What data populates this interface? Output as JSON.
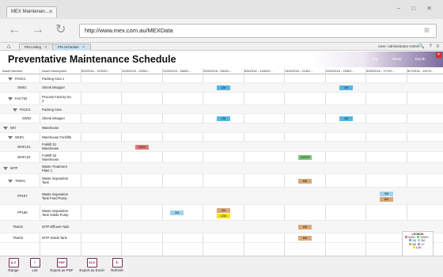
{
  "browser": {
    "tab_title": "MEX Maintenan...",
    "tab_close": "✕",
    "url": "http://www.mex.com.au/MEXData",
    "back_glyph": "←",
    "forward_glyph": "→",
    "refresh_glyph": "↻",
    "menu_glyph": "≡",
    "window_controls": "– □ ✕"
  },
  "app_tabs": [
    {
      "label": "PM Listing",
      "close": "✕"
    },
    {
      "label": "PM Schedule",
      "close": "✕"
    }
  ],
  "user_label": "User: Administrator Admin",
  "top_icons": "🔍 ? ≡",
  "page_title": "Preventative Maintenance Schedule",
  "view_buttons": {
    "day": "Day",
    "week": "Week",
    "month": "Month"
  },
  "close_glyph": "✕",
  "columns": {
    "asset_number": "Asset Number",
    "asset_description": "Asset Description",
    "weeks": [
      "5/5/2016 - 12/5/20...",
      "12/5/2016 - 20/5/2...",
      "21/5/2016 - 28/5/2...",
      "29/5/2016 - 5/6/20...",
      "6/6/2016 - 13/6/20...",
      "14/6/2016 - 21/6/2...",
      "22/6/2016 - 29/6/2...",
      "30/6/2016 - 7/7/20...",
      "8/7/2016 - 15/7/2..."
    ]
  },
  "rows": [
    {
      "num": "PACK1",
      "desc": [
        "Packing Area 1"
      ],
      "arrow": true,
      "indent": 1,
      "chips": []
    },
    {
      "num": "SW01",
      "desc": [
        "Shrink Wrapper"
      ],
      "arrow": false,
      "indent": 2,
      "chips": [
        {
          "label": "1M",
          "col": 3,
          "color": "#55b6e2"
        },
        {
          "label": "1M",
          "col": 6,
          "color": "#55b6e2"
        }
      ]
    },
    {
      "num": "FACT02",
      "desc": [
        "Process Factory No",
        "2"
      ],
      "arrow": true,
      "indent": 1,
      "chips": []
    },
    {
      "num": "PACK2",
      "desc": [
        "Packing Area"
      ],
      "arrow": true,
      "indent": 2,
      "chips": []
    },
    {
      "num": "SW02",
      "desc": [
        "Shrink Wrapper"
      ],
      "arrow": false,
      "indent": 3,
      "chips": [
        {
          "label": "1M",
          "col": 3,
          "color": "#55b6e2"
        },
        {
          "label": "1M",
          "col": 6,
          "color": "#55b6e2"
        }
      ]
    },
    {
      "num": "WH",
      "desc": [
        "Warehouse"
      ],
      "arrow": true,
      "indent": 0,
      "chips": []
    },
    {
      "num": "WHFL",
      "desc": [
        "Warehouse Forklifts"
      ],
      "arrow": true,
      "indent": 1,
      "chips": []
    },
    {
      "num": "WHFL01",
      "desc": [
        "Forklift 01",
        "Warehouse"
      ],
      "arrow": false,
      "indent": 2,
      "chips": [
        {
          "label": "600H",
          "col": 1,
          "color": "#e07a7a"
        }
      ]
    },
    {
      "num": "WHFL02",
      "desc": [
        "Forklift 02",
        "Warehouse"
      ],
      "arrow": false,
      "indent": 2,
      "chips": [
        {
          "label": "1000H",
          "col": 5,
          "color": "#7bc67b"
        }
      ]
    },
    {
      "num": "WTP",
      "desc": [
        "Waste Treatment",
        "Plant 1"
      ],
      "arrow": true,
      "indent": 0,
      "chips": []
    },
    {
      "num": "TNK01",
      "desc": [
        "Waste Separation",
        "Tank"
      ],
      "arrow": true,
      "indent": 1,
      "chips": [
        {
          "label": "6M",
          "col": 5,
          "color": "#d9a877"
        }
      ]
    },
    {
      "num": "PP167",
      "desc": [
        "Waste Separation",
        "Tank Feed Pump"
      ],
      "arrow": false,
      "indent": 2,
      "chips": [
        {
          "label": "3M",
          "col": 7,
          "color": "#9fd3ec",
          "top": true
        },
        {
          "label": "6M",
          "col": 7,
          "color": "#d9a877",
          "top": false
        }
      ]
    },
    {
      "num": "PP198",
      "desc": [
        "Waste Separation",
        "Tank Solids Pump"
      ],
      "arrow": false,
      "indent": 2,
      "chips": [
        {
          "label": "3M",
          "col": 2,
          "color": "#9fd3ec",
          "offset": 0.5
        },
        {
          "label": "6M",
          "col": 3,
          "color": "#d9a877",
          "top": true
        },
        {
          "label": "12M",
          "col": 3,
          "color": "#f5e31c",
          "top": false
        }
      ]
    },
    {
      "num": "TNK02",
      "desc": [
        "WTP Effluent Tank"
      ],
      "arrow": false,
      "indent": 1,
      "chips": [
        {
          "label": "6M",
          "col": 5,
          "color": "#d9a877"
        }
      ]
    },
    {
      "num": "TNK03",
      "desc": [
        "WTP Solids Tank"
      ],
      "arrow": false,
      "indent": 1,
      "chips": [
        {
          "label": "6M",
          "col": 5,
          "color": "#d9a877"
        }
      ]
    }
  ],
  "legend": {
    "title": "LEGEND",
    "items": [
      {
        "label": "600H",
        "color": "#e07a7a"
      },
      {
        "label": "1000H",
        "color": "#7bc67b"
      },
      {
        "label": "1M",
        "color": "#55b6e2"
      },
      {
        "label": "3M",
        "color": "#9fd3ec"
      },
      {
        "label": "6M",
        "color": "#d9a877"
      },
      {
        "label": "1Y",
        "color": "#c58fd0"
      },
      {
        "label": "12M",
        "color": "#f5e31c"
      }
    ]
  },
  "bottom_buttons": [
    {
      "label": "Range",
      "icon": "A-Z",
      "icon_name": "range-icon"
    },
    {
      "label": "List",
      "icon": "≡",
      "icon_name": "list-icon"
    },
    {
      "label": "Export as PDF",
      "icon": "PDF",
      "icon_name": "pdf-icon"
    },
    {
      "label": "Export as Excel",
      "icon": "XLS",
      "icon_name": "excel-icon"
    },
    {
      "label": "Refresh",
      "icon": "↻",
      "icon_name": "refresh-icon"
    }
  ]
}
